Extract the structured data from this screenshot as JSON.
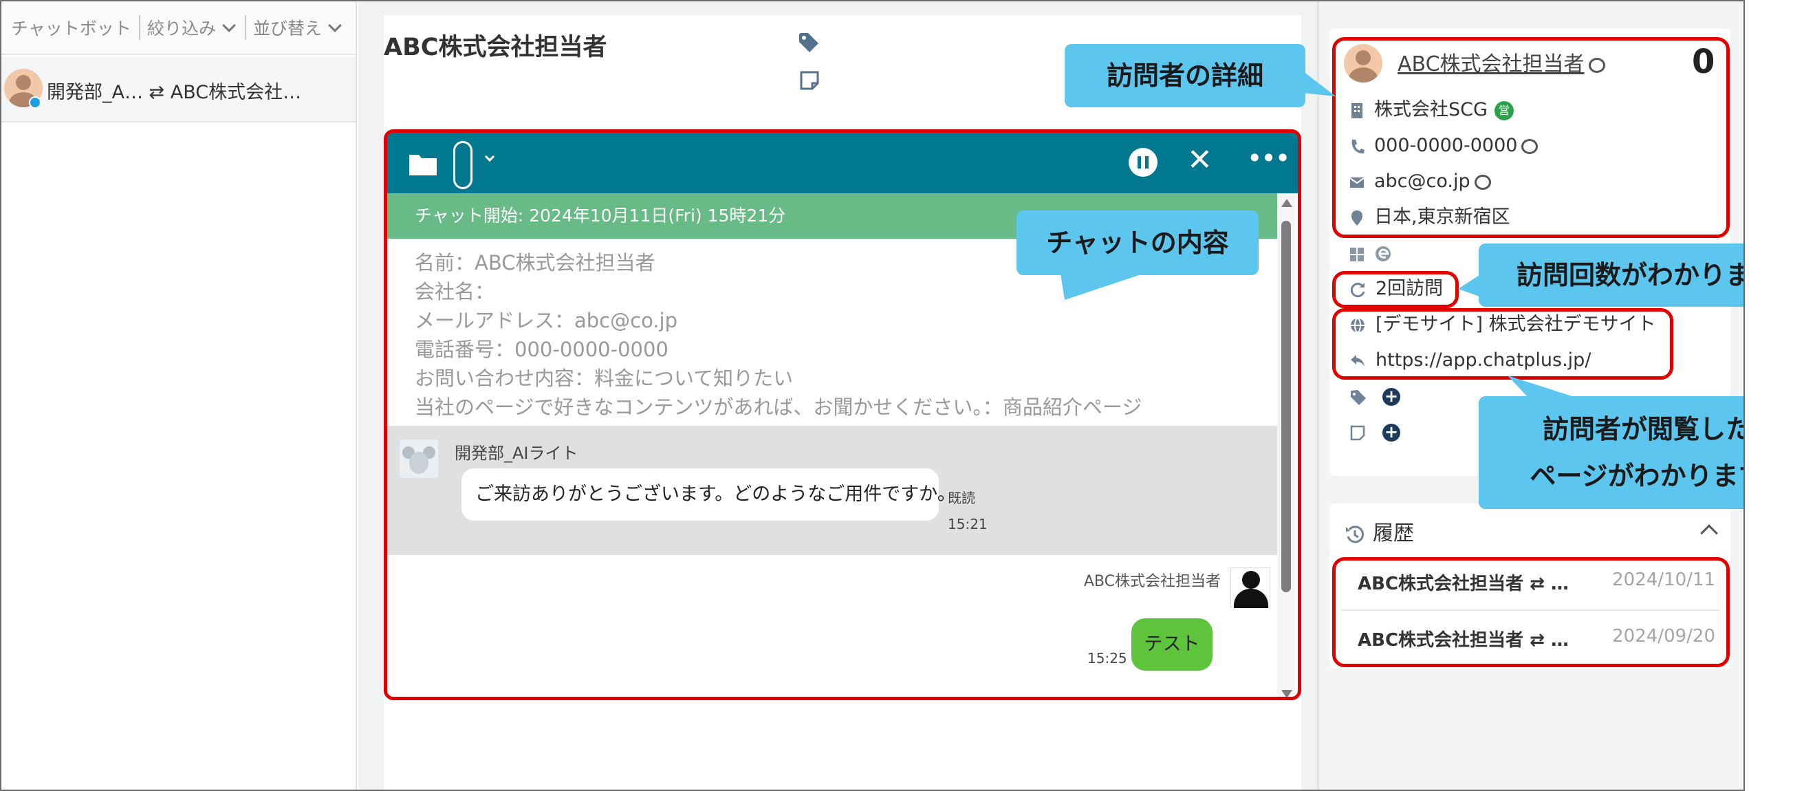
{
  "left_panel": {
    "filters": {
      "chatbot": "チャットボット",
      "filter": "絞り込み",
      "sort": "並び替え"
    },
    "conversation": {
      "title": "開発部_A… ⇄ ABC株式会社…"
    }
  },
  "main": {
    "title": "ABC株式会社担当者",
    "chat": {
      "start_label": "チャット開始: 2024年10月11日(Fri) 15時21分",
      "form_lines": [
        "名前：ABC株式会社担当者",
        "会社名：",
        "メールアドレス：abc@co.jp",
        "電話番号：000-0000-0000",
        "お問い合わせ内容：料金について知りたい",
        "当社のページで好きなコンテンツがあれば、お聞かせください。：商品紹介ページ"
      ],
      "bot_name": "開発部_AIライト",
      "bot_message": "ご来訪ありがとうございます。どのようなご用件ですか。",
      "bot_read": "既読",
      "bot_time": "15:21",
      "user_name": "ABC株式会社担当者",
      "user_message": "テスト",
      "user_time": "15:25"
    }
  },
  "visitor": {
    "name": "ABC株式会社担当者",
    "count": "0",
    "company": "株式会社SCG",
    "company_badge": "営",
    "phone": "000-0000-0000",
    "email": "abc@co.jp",
    "location": "日本,東京新宿区",
    "visits": "2回訪問",
    "site": "[デモサイト] 株式会社デモサイト",
    "url": "https://app.chatplus.jp/"
  },
  "history": {
    "title": "履歴",
    "items": [
      {
        "name": "ABC株式会社担当者 ⇄ …",
        "date": "2024/10/11"
      },
      {
        "name": "ABC株式会社担当者 ⇄ …",
        "date": "2024/09/20"
      }
    ]
  },
  "callouts": {
    "visitor_details": "訪問者の詳細",
    "chat_content": "チャットの内容",
    "visit_count": "訪問回数がわかります",
    "viewed_pages_1": "訪問者が閲覧した",
    "viewed_pages_2": "ページがわかります"
  },
  "colors": {
    "accent": "#00788f",
    "highlight": "#e00000",
    "callout": "#5cc6ee",
    "start_bar": "#68bb86"
  }
}
